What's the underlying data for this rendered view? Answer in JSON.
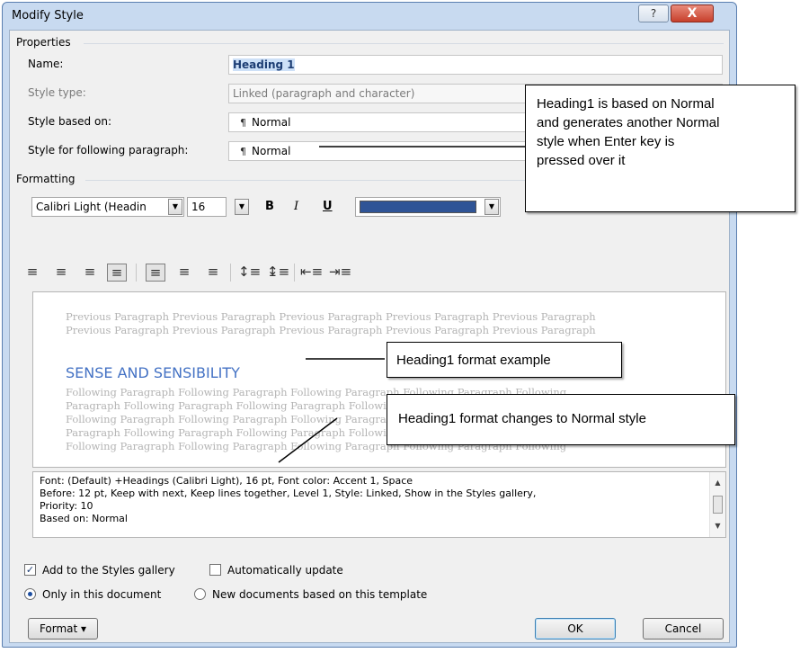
{
  "window": {
    "title": "Modify Style",
    "help_icon": "?",
    "close_icon": "X"
  },
  "properties": {
    "section_label": "Properties",
    "name_label": "Name:",
    "name_value": "Heading 1",
    "style_type_label": "Style type:",
    "style_type_value": "Linked (paragraph and character)",
    "based_on_label": "Style based on:",
    "based_on_value": "Normal",
    "following_label": "Style for following paragraph:",
    "following_value": "Normal",
    "pilcrow": "¶"
  },
  "formatting": {
    "section_label": "Formatting",
    "font_value": "Calibri Light (Headings)",
    "font_display": "Calibri Light (Headin",
    "size_value": "16",
    "bold_label": "B",
    "italic_label": "I",
    "underline_label": "U",
    "font_color": "#2f5496",
    "align_glyph": "≡",
    "line_spacing_glyph": "↕≡",
    "para_spacing_glyph": "↨≡",
    "indent_decrease_glyph": "⇤≡",
    "indent_increase_glyph": "⇥≡"
  },
  "preview": {
    "previous_lines": [
      "Previous  Paragraph  Previous  Paragraph  Previous  Paragraph  Previous  Paragraph  Previous  Paragraph",
      "Previous Paragraph Previous Paragraph Previous Paragraph Previous Paragraph Previous Paragraph"
    ],
    "heading_text": "SENSE AND SENSIBILITY",
    "following_lines": [
      "Following  Paragraph  Following  Paragraph  Following  Paragraph  Following  Paragraph  Following",
      "Paragraph  Following  Paragraph  Following  Paragraph  Following  Paragraph  Following  Paragraph",
      "Following  Paragraph  Following  Paragraph  Following  Paragraph  Following  Paragraph  Following",
      "Paragraph  Following  Paragraph  Following  Paragraph  Following  Paragraph  Following  Paragraph",
      "Following  Paragraph  Following  Paragraph  Following  Paragraph  Following  Paragraph  Following"
    ]
  },
  "description": {
    "lines": [
      "Font: (Default) +Headings (Calibri Light), 16 pt, Font color: Accent 1, Space",
      "   Before:  12 pt, Keep with next, Keep lines together, Level 1, Style: Linked, Show in the Styles gallery,",
      "Priority: 10",
      "   Based on: Normal"
    ]
  },
  "options": {
    "add_to_gallery_label": "Add to the Styles gallery",
    "add_to_gallery_checked": true,
    "auto_update_label": "Automatically update",
    "auto_update_checked": false,
    "only_doc_label": "Only in this document",
    "new_docs_label": "New documents based on this template",
    "selected_scope": "only_doc"
  },
  "buttons": {
    "format_label": "Format ▾",
    "ok_label": "OK",
    "cancel_label": "Cancel"
  },
  "callouts": {
    "based_on_note": [
      "Heading1 is based on Normal",
      "and generates  another Normal",
      "style when Enter key is",
      "pressed over it"
    ],
    "format_example_note": "Heading1 format example",
    "format_change_note": "Heading1 format changes to Normal style"
  }
}
